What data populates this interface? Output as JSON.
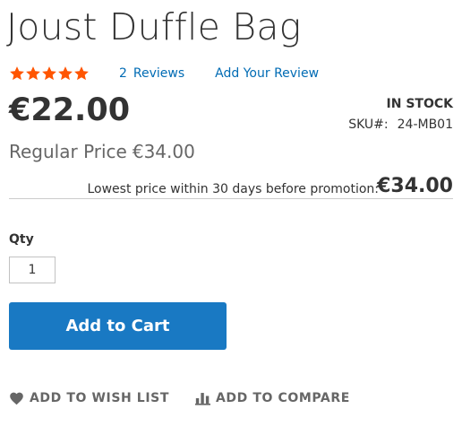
{
  "product": {
    "title": "Joust Duffle Bag",
    "rating_percent": 100,
    "review_count": "2",
    "reviews_label": "Reviews",
    "add_review_label": "Add Your Review",
    "final_price": "€22.00",
    "stock_status": "In stock",
    "sku_label": "SKU#:",
    "sku": "24-MB01",
    "regular_price_label": "Regular Price",
    "regular_price": "€34.00",
    "lowest_price_label": "Lowest price within 30 days before promotion:",
    "lowest_price": "€34.00"
  },
  "form": {
    "qty_label": "Qty",
    "qty_value": "1",
    "add_to_cart_label": "Add to Cart"
  },
  "actions": {
    "wishlist_label": "Add to Wish List",
    "wishlist_icon": "heart-icon",
    "compare_label": "Add to Compare",
    "compare_icon": "bar-chart-icon"
  },
  "colors": {
    "link": "#006bb4",
    "star": "#ff5501",
    "primary_button": "#1979c3",
    "muted_text": "#666666"
  }
}
